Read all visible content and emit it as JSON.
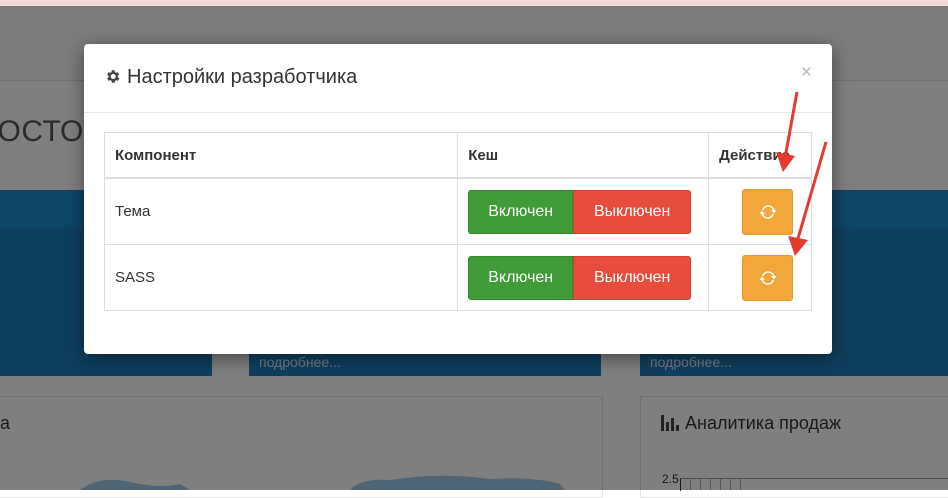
{
  "background": {
    "page_title": "СОСТОЯНИЕ",
    "tile_link_1": "подробнее...",
    "tile_link_2": "подробнее...",
    "panel_left_title": "а",
    "panel_right_title": "Аналитика продаж",
    "chart_y_tick": "2.5"
  },
  "modal": {
    "title": "Настройки разработчика",
    "close_label": "×",
    "table": {
      "headers": [
        "Компонент",
        "Кеш",
        "Действие"
      ],
      "rows": [
        {
          "component": "Тема",
          "on_label": "Включен",
          "off_label": "Выключен"
        },
        {
          "component": "SASS",
          "on_label": "Включен",
          "off_label": "Выключен"
        }
      ]
    }
  },
  "colors": {
    "on": "#3e9b37",
    "off": "#e84c3d",
    "refresh": "#f3a63a",
    "annotation_arrow": "#e53a2e"
  },
  "icons": {
    "title_icon": "gear-icon",
    "action_icon": "refresh-icon",
    "panel_icon": "bar-chart-icon"
  }
}
